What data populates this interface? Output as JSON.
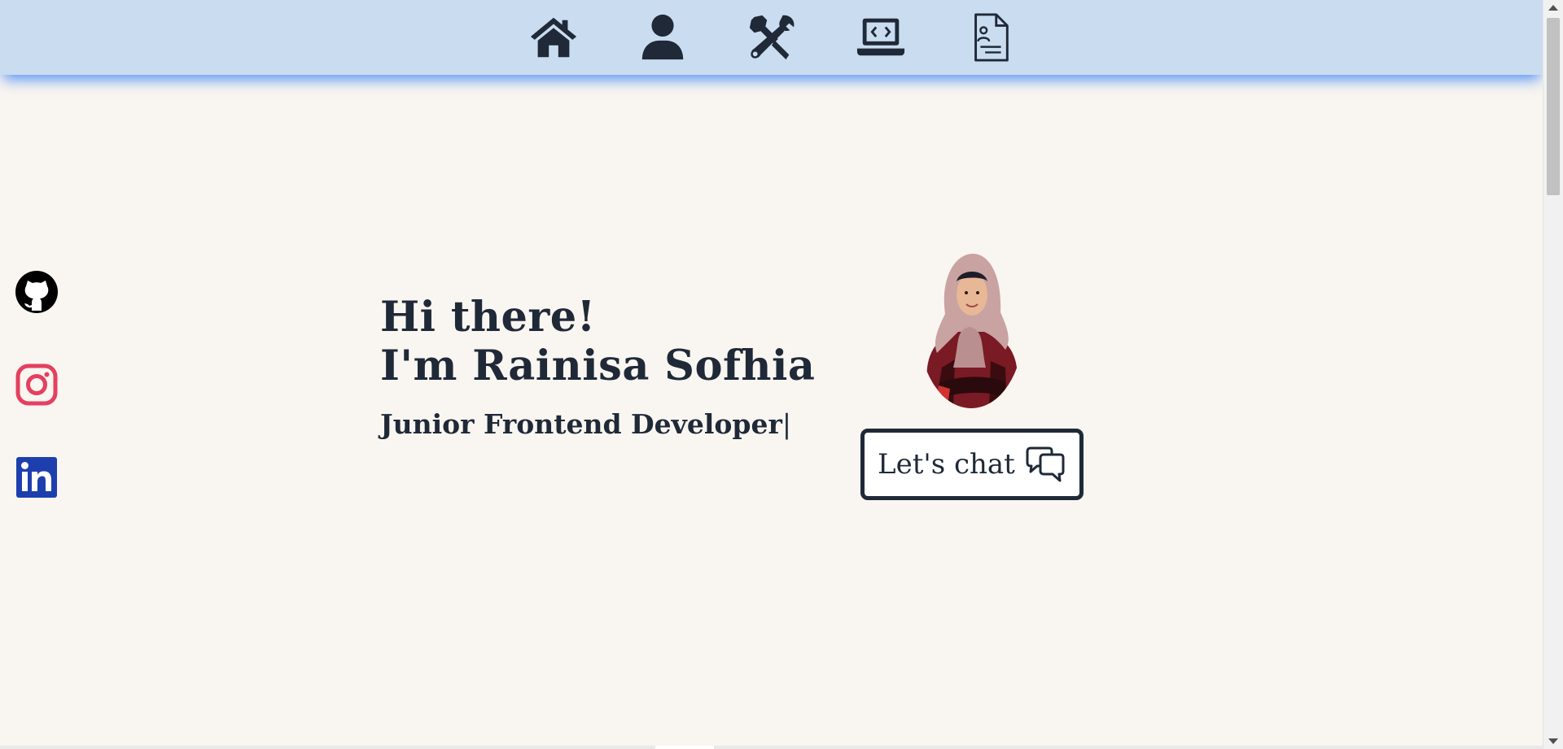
{
  "nav": {
    "items": [
      {
        "icon": "home-icon",
        "name": "home"
      },
      {
        "icon": "user-icon",
        "name": "about"
      },
      {
        "icon": "tools-icon",
        "name": "skills"
      },
      {
        "icon": "laptop-code-icon",
        "name": "projects"
      },
      {
        "icon": "resume-icon",
        "name": "resume"
      }
    ],
    "background": "#cadcf0",
    "shadow_color": "#3d85f5"
  },
  "social": [
    {
      "icon": "github-icon",
      "color": "#000000"
    },
    {
      "icon": "instagram-icon",
      "color": "#e4405f"
    },
    {
      "icon": "linkedin-icon",
      "color": "#1d3fae"
    }
  ],
  "hero": {
    "greeting_line1": "Hi there!",
    "greeting_line2": "I'm Rainisa Sofhia",
    "role": "Junior Frontend Developer",
    "cursor": "|"
  },
  "avatar": {
    "icon": "profile-photo"
  },
  "chat_button": {
    "label": "Let's chat",
    "icon": "chat-bubbles-icon"
  },
  "colors": {
    "page_bg": "#f9f5f0",
    "text": "#1f2937"
  }
}
